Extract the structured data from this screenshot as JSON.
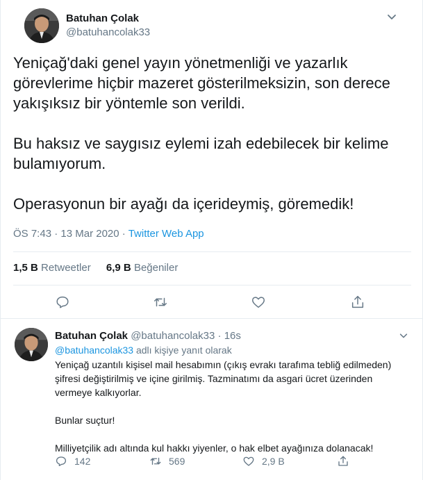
{
  "main_tweet": {
    "author_name": "Batuhan Çolak",
    "author_handle": "@batuhancolak33",
    "text": "Yeniçağ'daki genel yayın yönetmenliği ve yazarlık görevlerime hiçbir mazeret gösterilmeksizin, son derece yakışıksız bir yöntemle son verildi.\n\nBu haksız ve saygısız eylemi izah edebilecek bir kelime bulamıyorum.\n\nOperasyonun bir ayağı da içerideymiş, göremedik!",
    "time": "ÖS 7:43",
    "date": "13 Mar 2020",
    "separator": "·",
    "source": "Twitter Web App",
    "retweets_count": "1,5 B",
    "retweets_label": "Retweetler",
    "likes_count": "6,9 B",
    "likes_label": "Beğeniler"
  },
  "reply_tweet": {
    "author_name": "Batuhan Çolak",
    "author_handle": "@batuhancolak33",
    "separator": "·",
    "age": "16s",
    "reply_to_handle": "@batuhancolak33",
    "reply_to_suffix": "adlı kişiye yanıt olarak",
    "text": "Yeniçağ uzantılı kişisel mail hesabımın (çıkış evrakı tarafıma tebliğ edilmeden) şifresi değiştirilmiş ve içine girilmiş. Tazminatımı da asgari ücret üzerinden vermeye kalkıyorlar.\n\nBunlar suçtur!\n\nMilliyetçilik adı altında kul hakkı yiyenler, o hak elbet ayağınıza dolanacak!",
    "reply_count": "142",
    "retweet_count": "569",
    "like_count": "2,9 B"
  },
  "icons": {
    "reply": "reply-icon",
    "retweet": "retweet-icon",
    "like": "heart-icon",
    "share": "share-icon",
    "caret": "chevron-down-icon"
  },
  "colors": {
    "text": "#14171a",
    "secondary": "#657786",
    "link": "#1b95e0",
    "divider": "#e6ecf0"
  }
}
